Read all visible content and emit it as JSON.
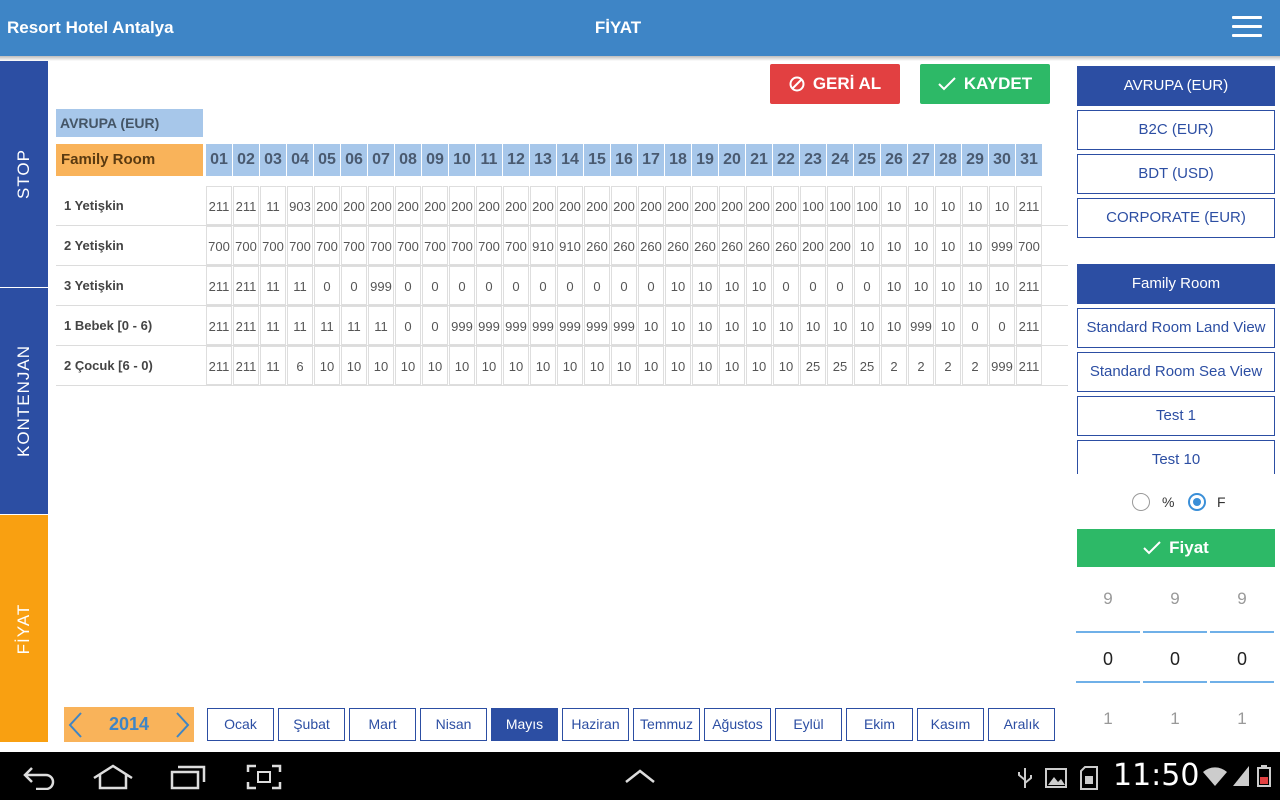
{
  "app": {
    "title": "Resort Hotel Antalya",
    "page_title": "FİYAT"
  },
  "sidetabs": [
    "STOP",
    "KONTENJAN",
    "FİYAT"
  ],
  "actions": {
    "undo": "GERİ AL",
    "save": "KAYDET",
    "price": "Fiyat"
  },
  "grid": {
    "currency": "AVRUPA (EUR)",
    "room": "Family Room",
    "days": [
      "01",
      "02",
      "03",
      "04",
      "05",
      "06",
      "07",
      "08",
      "09",
      "10",
      "11",
      "12",
      "13",
      "14",
      "15",
      "16",
      "17",
      "18",
      "19",
      "20",
      "21",
      "22",
      "23",
      "24",
      "25",
      "26",
      "27",
      "28",
      "29",
      "30",
      "31"
    ],
    "rows": [
      {
        "label": "1 Yetişkin",
        "values": [
          "211",
          "211",
          "11",
          "903",
          "200",
          "200",
          "200",
          "200",
          "200",
          "200",
          "200",
          "200",
          "200",
          "200",
          "200",
          "200",
          "200",
          "200",
          "200",
          "200",
          "200",
          "200",
          "100",
          "100",
          "100",
          "10",
          "10",
          "10",
          "10",
          "10",
          "211"
        ]
      },
      {
        "label": "2 Yetişkin",
        "values": [
          "700",
          "700",
          "700",
          "700",
          "700",
          "700",
          "700",
          "700",
          "700",
          "700",
          "700",
          "700",
          "910",
          "910",
          "260",
          "260",
          "260",
          "260",
          "260",
          "260",
          "260",
          "260",
          "200",
          "200",
          "10",
          "10",
          "10",
          "10",
          "10",
          "999",
          "700"
        ]
      },
      {
        "label": "3 Yetişkin",
        "values": [
          "211",
          "211",
          "11",
          "11",
          "0",
          "0",
          "999",
          "0",
          "0",
          "0",
          "0",
          "0",
          "0",
          "0",
          "0",
          "0",
          "0",
          "10",
          "10",
          "10",
          "10",
          "0",
          "0",
          "0",
          "0",
          "10",
          "10",
          "10",
          "10",
          "10",
          "211"
        ]
      },
      {
        "label": "1 Bebek [0 - 6)",
        "values": [
          "211",
          "211",
          "11",
          "11",
          "11",
          "11",
          "11",
          "0",
          "0",
          "999",
          "999",
          "999",
          "999",
          "999",
          "999",
          "999",
          "10",
          "10",
          "10",
          "10",
          "10",
          "10",
          "10",
          "10",
          "10",
          "10",
          "999",
          "10",
          "0",
          "0",
          "211"
        ]
      },
      {
        "label": "2 Çocuk [6 - 0)",
        "values": [
          "211",
          "211",
          "11",
          "6",
          "10",
          "10",
          "10",
          "10",
          "10",
          "10",
          "10",
          "10",
          "10",
          "10",
          "10",
          "10",
          "10",
          "10",
          "10",
          "10",
          "10",
          "10",
          "25",
          "25",
          "25",
          "2",
          "2",
          "2",
          "2",
          "999",
          "211"
        ]
      }
    ]
  },
  "year": "2014",
  "months": [
    "Ocak",
    "Şubat",
    "Mart",
    "Nisan",
    "Mayıs",
    "Haziran",
    "Temmuz",
    "Ağustos",
    "Eylül",
    "Ekim",
    "Kasım",
    "Aralık"
  ],
  "active_month": "Mayıs",
  "price_lists": [
    {
      "label": "AVRUPA (EUR)",
      "active": true
    },
    {
      "label": "B2C (EUR)",
      "active": false
    },
    {
      "label": "BDT (USD)",
      "active": false
    },
    {
      "label": "CORPORATE (EUR)",
      "active": false
    }
  ],
  "rooms": [
    {
      "label": "Family Room",
      "active": true
    },
    {
      "label": "Standard Room Land View",
      "active": false
    },
    {
      "label": "Standard Room Sea View",
      "active": false
    },
    {
      "label": "Test 1",
      "active": false
    },
    {
      "label": "Test 10",
      "active": false
    }
  ],
  "mode": {
    "options": [
      "%",
      "F"
    ],
    "selected": "F"
  },
  "pickers": [
    {
      "prev": "9",
      "value": "0",
      "next": "1"
    },
    {
      "prev": "9",
      "value": "0",
      "next": "1"
    },
    {
      "prev": "9",
      "value": "0",
      "next": "1"
    }
  ],
  "status_bar": {
    "time": "11:50"
  },
  "colors": {
    "appbar": "#3e85c6",
    "navy": "#2c4ea3",
    "orange": "#f9a011",
    "green": "#2db967",
    "red": "#e24041",
    "header_cell": "#a7c7ea"
  }
}
